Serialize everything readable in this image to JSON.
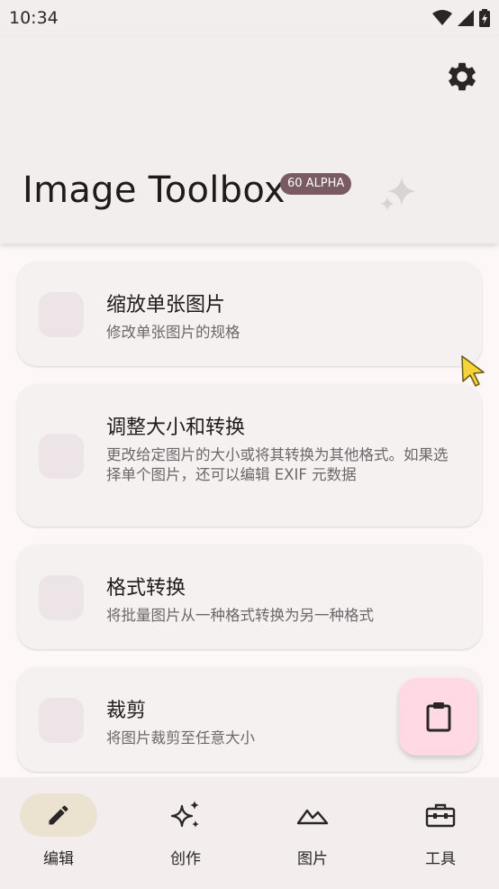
{
  "status": {
    "time": "10:34"
  },
  "header": {
    "title": "Image Toolbox",
    "version_badge": "60 ALPHA"
  },
  "cards": [
    {
      "title": "缩放单张图片",
      "description": "修改单张图片的规格"
    },
    {
      "title": "调整大小和转换",
      "description": "更改给定图片的大小或将其转换为其他格式。如果选择单个图片，还可以编辑 EXIF 元数据"
    },
    {
      "title": "格式转换",
      "description": "将批量图片从一种格式转换为另一种格式"
    },
    {
      "title": "裁剪",
      "description": "将图片裁剪至任意大小"
    }
  ],
  "nav": [
    {
      "label": "编辑",
      "icon": "pencil-icon",
      "active": true
    },
    {
      "label": "创作",
      "icon": "sparkles-icon",
      "active": false
    },
    {
      "label": "图片",
      "icon": "mountains-icon",
      "active": false
    },
    {
      "label": "工具",
      "icon": "toolbox-icon",
      "active": false
    }
  ],
  "fab": {
    "icon": "clipboard-icon"
  },
  "colors": {
    "accent_badge": "#7a5a63",
    "fab_bg": "#ffd9e3",
    "nav_active": "#ebe3d0"
  }
}
